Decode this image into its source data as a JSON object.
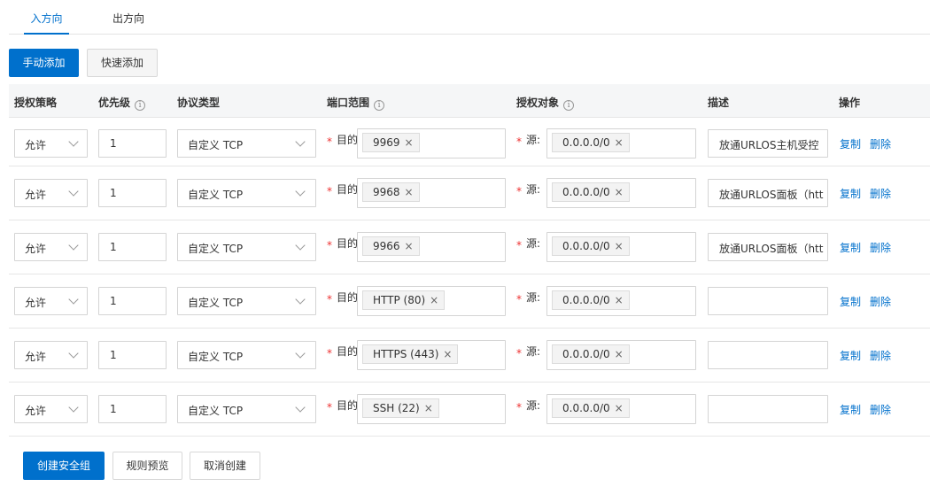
{
  "tabs": {
    "inbound": "入方向",
    "outbound": "出方向"
  },
  "toolbar": {
    "manual_add": "手动添加",
    "quick_add": "快速添加"
  },
  "columns": {
    "policy": "授权策略",
    "priority": "优先级",
    "protocol": "协议类型",
    "port_range": "端口范围",
    "auth_object": "授权对象",
    "description": "描述",
    "action": "操作",
    "info_glyph": "i"
  },
  "labels": {
    "required_mark": "*",
    "dest": "目的",
    "source": "源:",
    "tag_close": "×"
  },
  "rules": [
    {
      "policy": "允许",
      "priority": "1",
      "protocol": "自定义 TCP",
      "port": "9969",
      "source": "0.0.0.0/0",
      "description": "放通URLOS主机受控",
      "copy": "复制",
      "delete": "删除"
    },
    {
      "policy": "允许",
      "priority": "1",
      "protocol": "自定义 TCP",
      "port": "9968",
      "source": "0.0.0.0/0",
      "description": "放通URLOS面板（htt",
      "copy": "复制",
      "delete": "删除"
    },
    {
      "policy": "允许",
      "priority": "1",
      "protocol": "自定义 TCP",
      "port": "9966",
      "source": "0.0.0.0/0",
      "description": "放通URLOS面板（htt",
      "copy": "复制",
      "delete": "删除"
    },
    {
      "policy": "允许",
      "priority": "1",
      "protocol": "自定义 TCP",
      "port": "HTTP (80)",
      "source": "0.0.0.0/0",
      "description": "",
      "copy": "复制",
      "delete": "删除"
    },
    {
      "policy": "允许",
      "priority": "1",
      "protocol": "自定义 TCP",
      "port": "HTTPS (443)",
      "source": "0.0.0.0/0",
      "description": "",
      "copy": "复制",
      "delete": "删除"
    },
    {
      "policy": "允许",
      "priority": "1",
      "protocol": "自定义 TCP",
      "port": "SSH (22)",
      "source": "0.0.0.0/0",
      "description": "",
      "copy": "复制",
      "delete": "删除"
    }
  ],
  "footer": {
    "create": "创建安全组",
    "preview": "规则预览",
    "cancel": "取消创建"
  },
  "colors": {
    "primary": "#0070cc",
    "required": "#ee3333"
  }
}
